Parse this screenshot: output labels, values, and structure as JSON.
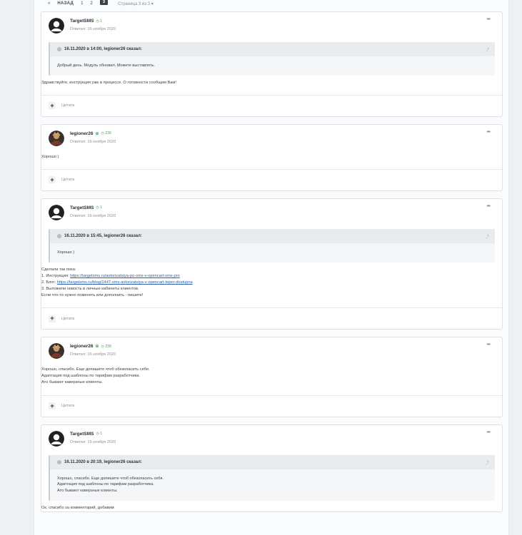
{
  "pagination": {
    "prev_icon": "«",
    "back_label": "НАЗАД",
    "pages": [
      "1",
      "2",
      "3"
    ],
    "current": "3",
    "jump_label": "Страница 3 из 3 ▾"
  },
  "posts": [
    {
      "author": "TargetSMS",
      "rep": "1",
      "verified": false,
      "meta": "Ответил: 16 ноября 2020",
      "more": "•••",
      "quote": {
        "head": "16.11.2020 в 14:00, legioner26 сказал:",
        "lines": [
          "Добрый день. Модуль обновил. Можете выставлять."
        ]
      },
      "lines": [
        "Здравствуйте, инструкция уже в процессе. О готовности сообщим Вам!"
      ],
      "plus": "+",
      "quote_label": "Цитата"
    },
    {
      "author": "legioner26",
      "rep": "239",
      "verified": true,
      "meta": "Ответил: 16 ноября 2020",
      "more": "•••",
      "lines": [
        "Хорошо )"
      ],
      "plus": "+",
      "quote_label": "Цитата"
    },
    {
      "author": "TargetSMS",
      "rep": "1",
      "verified": false,
      "meta": "Ответил: 16 ноября 2020",
      "more": "•••",
      "quote": {
        "head": "16.11.2020 в 15:45, legioner26 сказал:",
        "lines": [
          "Хорошо )"
        ]
      },
      "lines_rich": [
        {
          "text": "Сделали так пока:"
        },
        {
          "text": "1. Инструкция: ",
          "link": "https://targetsms.ru/avtorizatsiya-po-sms-v-opencart-sms-pro"
        },
        {
          "text": "2. Блог: ",
          "link": "https://targetsms.ru/blog/1447-sms-avtorizatsiya-v-opencart-teper-dostupna"
        },
        {
          "text": "3. Выложили новость в личные кабинеты клиентов."
        },
        {
          "text": "Если что-то нужно поменять или дополнить - пишите!"
        }
      ],
      "plus": "+",
      "quote_label": "Цитата"
    },
    {
      "author": "legioner26",
      "rep": "239",
      "verified": true,
      "meta": "Ответил: 16 ноября 2020",
      "more": "•••",
      "lines": [
        "Хорошо, спасибо. Еще допишите чтоб обезопасить себя.",
        "Адаптация под шаблоны по тарифам разработчика.",
        "Ато бывают каверзные клиенты."
      ],
      "plus": "+",
      "quote_label": "Цитата"
    },
    {
      "author": "TargetSMS",
      "rep": "1",
      "verified": false,
      "meta": "Ответил: 16 ноября 2020",
      "more": "•••",
      "quote": {
        "head": "16.11.2020 в 20:19, legioner26 сказал:",
        "lines": [
          "Хорошо, спасибо. Еще допишите чтоб обезопасить себя.",
          "Адаптация под шаблоны по тарифам разработчика.",
          "Ато бывают каверзные клиенты."
        ]
      },
      "lines": [
        "Ок, спасибо за комментарий, добавим"
      ]
    }
  ]
}
